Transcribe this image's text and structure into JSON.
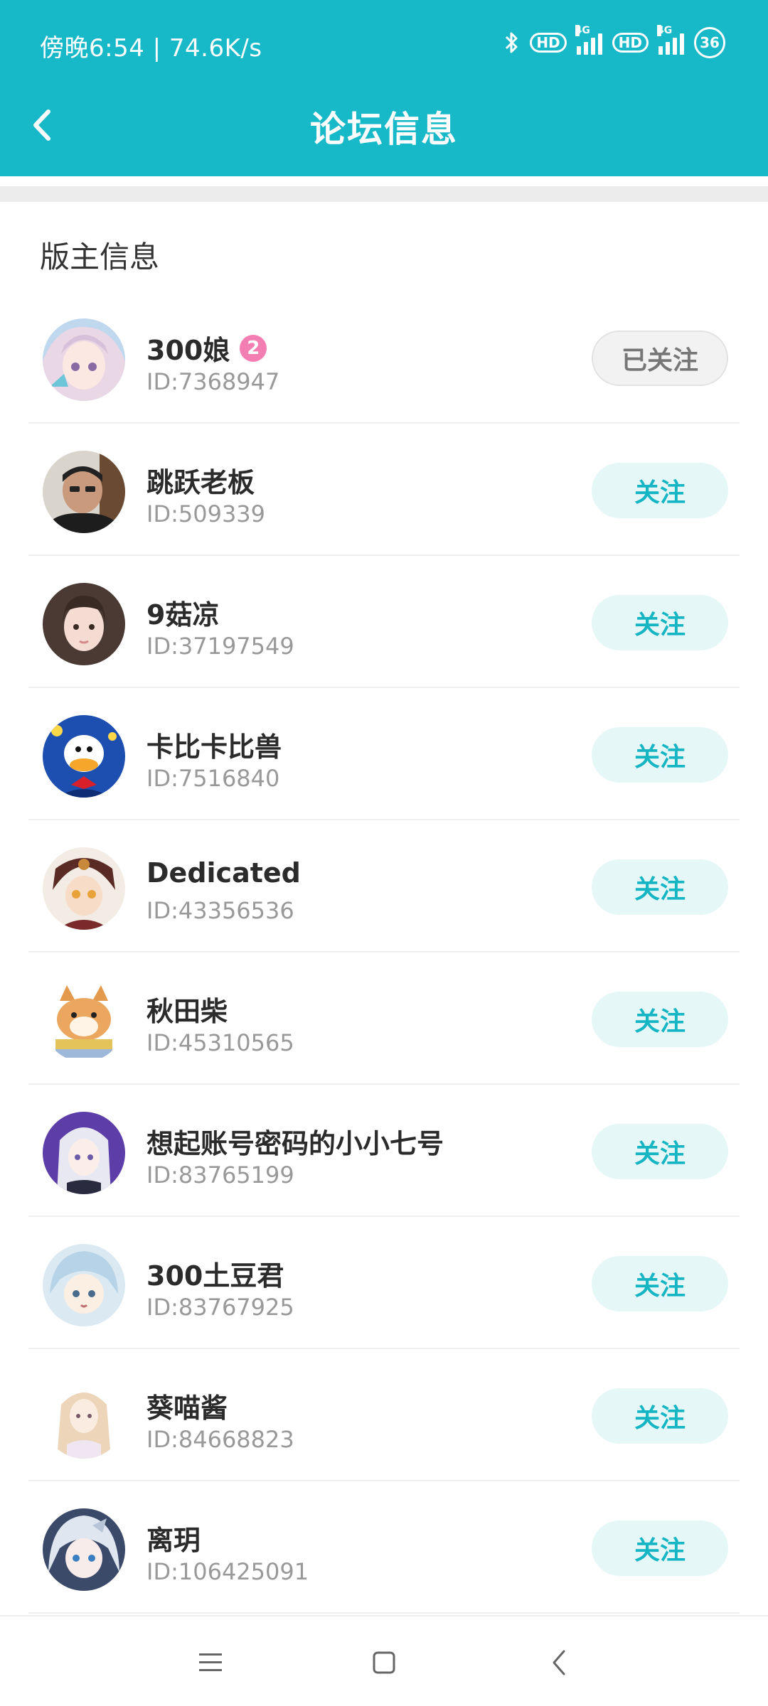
{
  "status_bar": {
    "time": "傍晚6:54 | 74.6K/s",
    "battery": "36",
    "hd1": "HD",
    "hd2": "HD",
    "net1": "4G",
    "net2": "4G",
    "icons": [
      "bluetooth-icon",
      "hd-badge",
      "signal-icon",
      "hd-badge",
      "signal-icon",
      "battery-icon"
    ]
  },
  "header": {
    "title": "论坛信息",
    "back_icon": "chevron-left-icon",
    "bg_color": "#17b8c7"
  },
  "section": {
    "title": "版主信息"
  },
  "moderators": [
    {
      "name": "300娘",
      "id": "ID:7368947",
      "level": "2",
      "button": "已关注",
      "followed": true
    },
    {
      "name": "跳跃老板",
      "id": "ID:509339",
      "button": "关注",
      "followed": false
    },
    {
      "name": "9菇凉",
      "id": "ID:37197549",
      "button": "关注",
      "followed": false
    },
    {
      "name": "卡比卡比兽",
      "id": "ID:7516840",
      "button": "关注",
      "followed": false
    },
    {
      "name": "Dedicated",
      "id": "ID:43356536",
      "button": "关注",
      "followed": false
    },
    {
      "name": "秋田柴",
      "id": "ID:45310565",
      "button": "关注",
      "followed": false
    },
    {
      "name": "想起账号密码的小小七号",
      "id": "ID:83765199",
      "button": "关注",
      "followed": false
    },
    {
      "name": "300土豆君",
      "id": "ID:83767925",
      "button": "关注",
      "followed": false
    },
    {
      "name": "葵喵酱",
      "id": "ID:84668823",
      "button": "关注",
      "followed": false
    },
    {
      "name": "离玥",
      "id": "ID:106425091",
      "button": "关注",
      "followed": false
    }
  ],
  "colors": {
    "accent": "#17b8c7",
    "follow_text": "#15b5c4",
    "follow_bg": "#e6f7f8",
    "followed_bg": "#f2f2f2",
    "level_badge": "#f27eb2"
  },
  "bottom_nav": [
    "menu-icon",
    "home-icon",
    "back-icon"
  ]
}
